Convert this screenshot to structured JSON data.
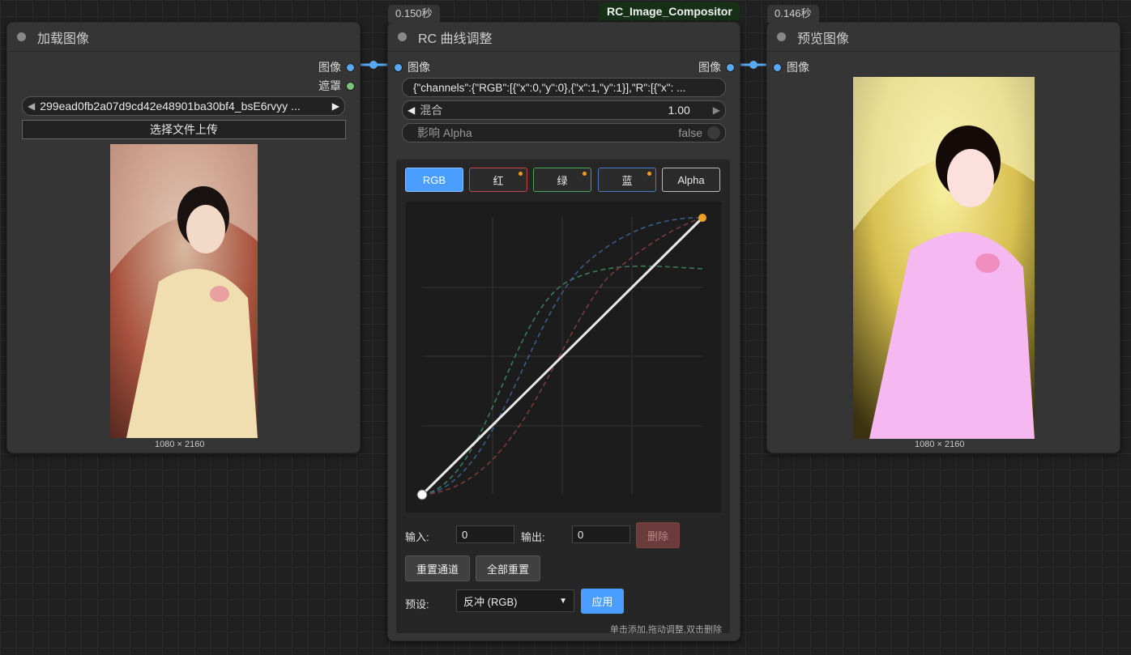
{
  "colors": {
    "slot_image": "#59a8f2",
    "slot_mask": "#7ac47a",
    "accent": "#4a9eff",
    "delete": "#6b3a3a",
    "point": "#f0a020"
  },
  "load_node": {
    "title": "加载图像",
    "out_image": "图像",
    "out_mask": "遮罩",
    "filename": "299ead0fb2a07d9cd42e48901ba30bf4_bsE6rvyy ...",
    "upload_label": "选择文件上传",
    "size_label": "1080 × 2160"
  },
  "curve_node": {
    "time_badge": "0.150秒",
    "title": "RC 曲线调整",
    "in_image": "图像",
    "out_image": "图像",
    "json_value": "{\"channels\":{\"RGB\":[{\"x\":0,\"y\":0},{\"x\":1,\"y\":1}],\"R\":[{\"x\": ...",
    "blend_label": "混合",
    "blend_value": "1.00",
    "alpha_label": "影响 Alpha",
    "alpha_value": "false",
    "tabs": [
      "RGB",
      "红",
      "绿",
      "蓝",
      "Alpha"
    ],
    "input_label": "输入:",
    "input_value": "0",
    "output_label": "输出:",
    "output_value": "0",
    "delete_label": "删除",
    "reset_channel_label": "重置通道",
    "reset_all_label": "全部重置",
    "preset_label": "预设:",
    "preset_value": "反冲 (RGB)",
    "apply_label": "应用",
    "hint": "单击添加,拖动调整,双击删除"
  },
  "compositor_badge": "RC_Image_Compositor",
  "preview_node": {
    "time_badge": "0.146秒",
    "title": "预览图像",
    "in_image": "图像",
    "size_label": "1080 × 2160"
  }
}
